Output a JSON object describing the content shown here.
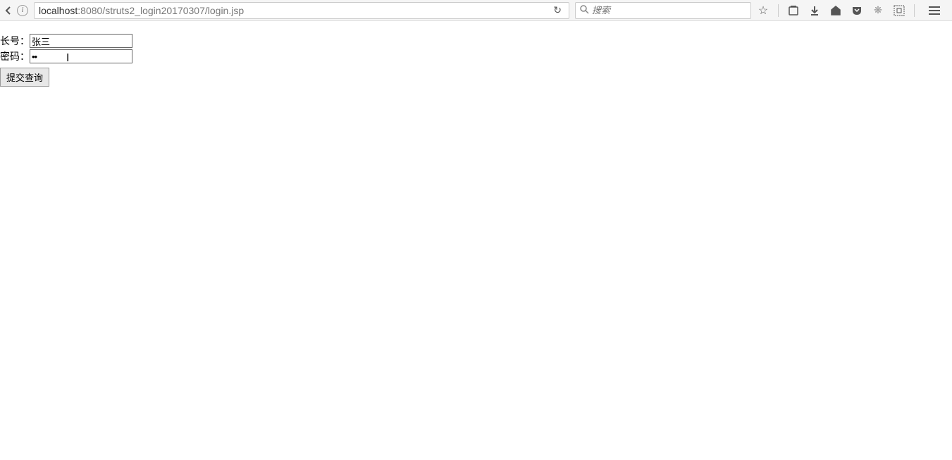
{
  "browser": {
    "url_host": "localhost",
    "url_port": ":8080",
    "url_path": "/struts2_login20170307/login.jsp",
    "search_placeholder": "搜索"
  },
  "form": {
    "username_label": "长号：",
    "username_value": "张三",
    "password_label": "密码：",
    "password_value": "••",
    "submit_label": "提交查询"
  }
}
